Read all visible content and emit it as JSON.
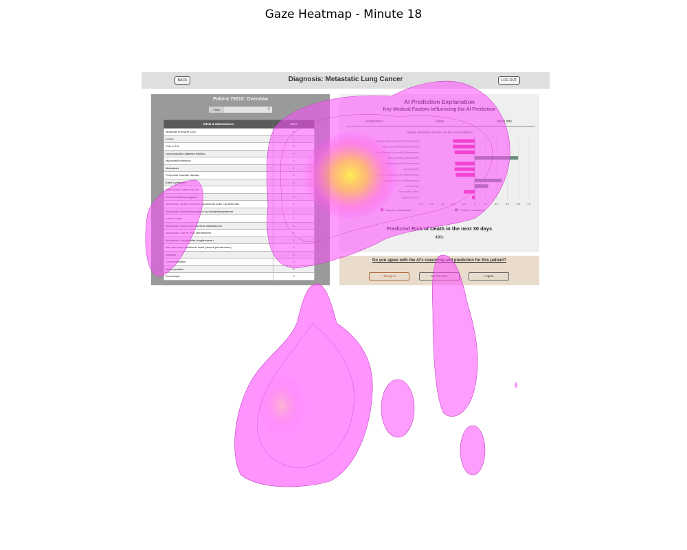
{
  "figure": {
    "title": "Gaze Heatmap - Minute 18"
  },
  "header": {
    "title": "Diagnosis: Metastatic Lung Cancer",
    "back_label": "BACK",
    "logout_label": "LOG OUT"
  },
  "patient": {
    "title": "Patient 79315: Overview",
    "filter_tab": "Vitals",
    "table_headers": [
      "Vitals & Informations",
      "Value"
    ],
    "rows": [
      {
        "label": "Moderate to severe CKD",
        "value": "0"
      },
      {
        "label": "COPD",
        "value": "0"
      },
      {
        "label": "CVA or TIA",
        "value": "0"
      },
      {
        "label": "Uncomplicated diabetes mellitus",
        "value": "0"
      },
      {
        "label": "Myocardial infarction",
        "value": "0"
      },
      {
        "label": "Metastasis",
        "value": "1"
      },
      {
        "label": "Peripheral vascular disease",
        "value": "0"
      },
      {
        "label": "Kræft i lymfevæv",
        "value": "0"
      },
      {
        "label": "Kræft i bryst, nakke og hals",
        "value": "1"
      },
      {
        "label": "Kræft i fordøjelsesorganer",
        "value": "0"
      },
      {
        "label": "Metastaser og ikke nærmere specificeret kræft i lymfeknuder",
        "value": "1"
      },
      {
        "label": "Metastaser i åndedrætsorganer og fordøjelsessystemet",
        "value": "0"
      },
      {
        "label": "Kræft i lunger",
        "value": "1"
      },
      {
        "label": "Metastaser i andre specificerede lokalisationer",
        "value": "0"
      },
      {
        "label": "Metastaser i hjerne eller hjernehinder",
        "value": "0"
      },
      {
        "label": "Metastaser i knogle eller knoglemarven",
        "value": "0"
      },
      {
        "label": "Ikke nærmere specificeret kræft (ukendt primærtumor)",
        "value": "0"
      },
      {
        "label": "Infektion",
        "value": "0"
      },
      {
        "label": "Urinvejsinfektion",
        "value": "0"
      },
      {
        "label": "Hjerte problem",
        "value": "0"
      },
      {
        "label": "Kemoterapi",
        "value": "0"
      }
    ]
  },
  "ai_panel": {
    "title": "AI Prediction Explanation",
    "subtitle": "Key Medical Factors Influencing the AI Prediction",
    "tabs": [
      "Instructions",
      "Chart",
      "More info"
    ],
    "chart_title": "Impact of Medical Factors on the AI's Prediction",
    "risk_title": "Predicted Risk of Death in the next 30 days",
    "risk_value": "49%"
  },
  "agree": {
    "question": "Do you agree with the AI's reasoning and prediction for this patient?",
    "disagree": "I Disagree",
    "not_sure": "I'm Not Sure",
    "agree": "I Agree"
  },
  "chart_data": {
    "type": "bar",
    "title": "Impact of Medical Factors on the AI's Prediction",
    "categories": [
      "Hydrogen carbonat (mmol/L) [Measurement]",
      "Haemoglobin (mmol/L) [Measurement]",
      "Base (Standard; B ( mmol/L)) [Measurement]",
      "Natrium (mmol/L) [Measurement]",
      "Glukose (mmol/L) [Measurement]",
      "Chlorid (mmol/L)",
      "Alanine transaminase (U/L) [Measurement]",
      "Erytrocyttes (10^12/L) [Measurement]",
      "Urea (mmol/L)",
      "Trombocytter (10^9/L)",
      "Kreatinin (umol/L)"
    ],
    "values": [
      -0.4,
      -0.4,
      -0.37,
      0.8,
      -0.36,
      -0.37,
      -0.35,
      0.5,
      0.25,
      -0.2,
      -0.05
    ],
    "xlim": [
      -1.0,
      1.0
    ],
    "xticks": [
      "-1.0",
      "-0.8",
      "-0.6",
      "-0.4",
      "-0.2",
      "0",
      "0.2",
      "0.4",
      "0.6",
      "0.8",
      "1.0"
    ],
    "legend": [
      "Negative Contribution",
      "Positive Contribution"
    ],
    "colors": {
      "negative": "#e2379a",
      "positive": "#6c8f7d"
    },
    "grid": true,
    "legend_position": "bottom"
  },
  "colors": {
    "topbar": "#dde0de",
    "left_panel": "#9a9a9a",
    "right_panel": "#efefef",
    "agree_panel": "#eadccc",
    "heat_low": "#ff4cff",
    "heat_high": "#fff34a"
  }
}
